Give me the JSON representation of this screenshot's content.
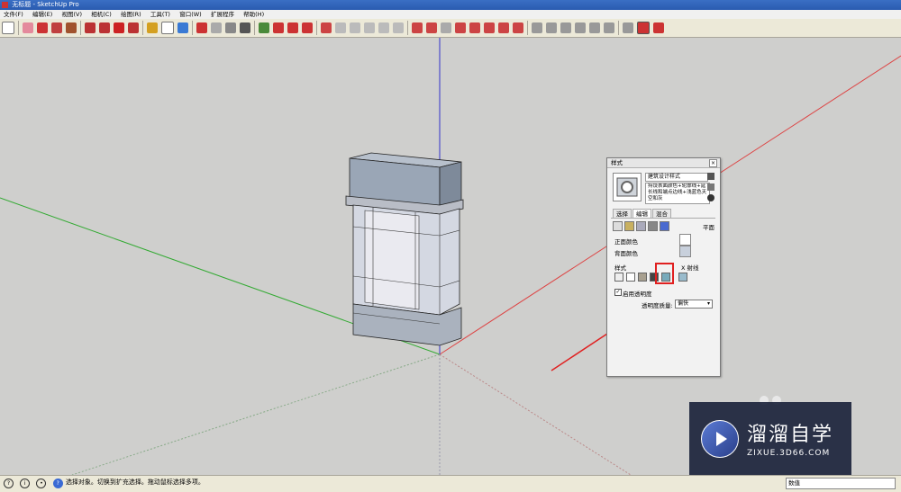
{
  "window": {
    "title": "无标题 - SketchUp Pro"
  },
  "menu": [
    "文件(F)",
    "编辑(E)",
    "视图(V)",
    "相机(C)",
    "绘图(R)",
    "工具(T)",
    "窗口(W)",
    "扩展程序",
    "帮助(H)"
  ],
  "toolbar": {
    "icons": [
      "select-tool",
      "eraser-tool",
      "pencil-tool",
      "arc-tool",
      "rectangle-tool",
      "push-pull-tool",
      "move-tool",
      "rotate-tool",
      "offset-tool",
      "tape-measure-tool",
      "text-tool",
      "paint-bucket-tool",
      "orbit-tool",
      "pan-tool",
      "zoom-tool",
      "zoom-extents-tool"
    ]
  },
  "styles_panel": {
    "title": "样式",
    "style_name": "建筑设计样式",
    "style_description": "持设表面颜色+轮廓线+延长线和端点边线+浅蓝色天空和灰",
    "tabs": [
      "选择",
      "编辑",
      "混合"
    ],
    "active_tab": "编辑",
    "plane_label": "平面",
    "front_color_label": "正面颜色",
    "back_color_label": "背面颜色",
    "style_section_label": "样式",
    "xray_label": "X 射线",
    "transparency_label": "启用透明度",
    "transparency_quality_label": "透明度质量:",
    "transparency_quality_value": "偏快",
    "front_color": "#ffffff",
    "back_color": "#c8d0dc"
  },
  "status": {
    "text": "选择对象。切换到扩充选择。拖动鼠标选择多项。",
    "measurement_label": "数值"
  },
  "watermark": {
    "title": "溜溜自学",
    "subtitle": "ZIXUE.3D66.COM"
  }
}
